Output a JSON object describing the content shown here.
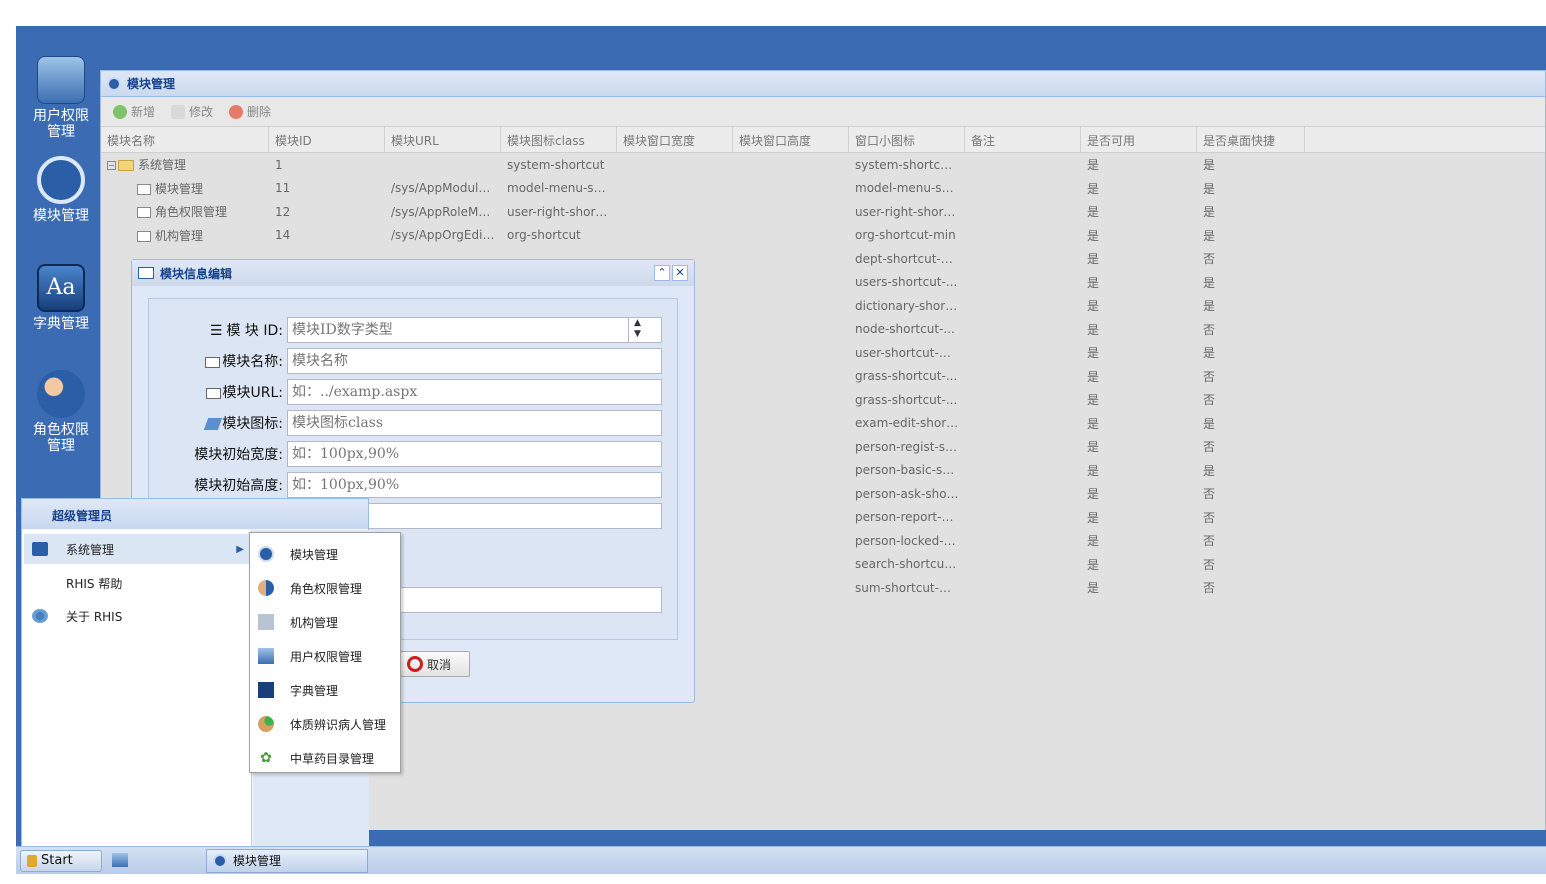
{
  "desktop": {
    "icons": [
      {
        "label": "用户权限\n管理",
        "icon": "user-permission-icon"
      },
      {
        "label": "模块管理",
        "icon": "module-icon"
      },
      {
        "label": "字典管理",
        "icon": "dictionary-icon"
      },
      {
        "label": "角色权限\n管理",
        "icon": "role-permission-icon"
      }
    ]
  },
  "window": {
    "title": "模块管理",
    "toolbar": {
      "add": "新增",
      "edit": "修改",
      "delete": "删除"
    },
    "columns": [
      "模块名称",
      "模块ID",
      "模块URL",
      "模块图标class",
      "模块窗口宽度",
      "模块窗口高度",
      "窗口小图标",
      "备注",
      "是否可用",
      "是否桌面快捷"
    ],
    "rows": [
      {
        "name": "系统管理",
        "id": "1",
        "url": "",
        "icon_class": "system-shortcut",
        "small_icon": "system-shortcut...",
        "enabled": "是",
        "desktop": "是"
      },
      {
        "name": "模块管理",
        "id": "11",
        "url": "/sys/AppModule...",
        "icon_class": "model-menu-sh...",
        "small_icon": "model-menu-sh...",
        "enabled": "是",
        "desktop": "是"
      },
      {
        "name": "角色权限管理",
        "id": "12",
        "url": "/sys/AppRoleMo...",
        "icon_class": "user-right-short...",
        "small_icon": "user-right-short...",
        "enabled": "是",
        "desktop": "是"
      },
      {
        "name": "机构管理",
        "id": "14",
        "url": "/sys/AppOrgEdit...",
        "icon_class": "org-shortcut",
        "small_icon": "org-shortcut-min",
        "enabled": "是",
        "desktop": "是"
      },
      {
        "small_icon": "dept-shortcut-min",
        "enabled": "是",
        "desktop": "否"
      },
      {
        "small_icon": "users-shortcut-...",
        "enabled": "是",
        "desktop": "是"
      },
      {
        "small_icon": "dictionary-short...",
        "enabled": "是",
        "desktop": "是"
      },
      {
        "small_icon": "node-shortcut-...",
        "enabled": "是",
        "desktop": "否"
      },
      {
        "small_icon": "user-shortcut-min",
        "enabled": "是",
        "desktop": "是"
      },
      {
        "small_icon": "grass-shortcut-...",
        "enabled": "是",
        "desktop": "否"
      },
      {
        "small_icon": "grass-shortcut-...",
        "enabled": "是",
        "desktop": "否"
      },
      {
        "small_icon": "exam-edit-short...",
        "enabled": "是",
        "desktop": "是"
      },
      {
        "small_icon": "person-regist-sh...",
        "enabled": "是",
        "desktop": "否"
      },
      {
        "small_icon": "person-basic-sh...",
        "enabled": "是",
        "desktop": "是"
      },
      {
        "small_icon": "person-ask-shor...",
        "enabled": "是",
        "desktop": "否"
      },
      {
        "small_icon": "person-report-s...",
        "enabled": "是",
        "desktop": "否"
      },
      {
        "small_icon": "person-locked-s...",
        "enabled": "是",
        "desktop": "否"
      },
      {
        "small_icon": "search-shortcut...",
        "enabled": "是",
        "desktop": "否"
      },
      {
        "small_icon": "sum-shortcut-min",
        "enabled": "是",
        "desktop": "否"
      }
    ]
  },
  "dialog": {
    "title": "模块信息编辑",
    "fields": [
      {
        "label": "模 块 ID:",
        "placeholder": "模块ID数字类型"
      },
      {
        "label": "模块名称:",
        "placeholder": "模块名称"
      },
      {
        "label": "模块URL:",
        "placeholder": "如：../examp.aspx"
      },
      {
        "label": "模块图标:",
        "placeholder": "模块图标class"
      },
      {
        "label": "模块初始宽度:",
        "placeholder": "如：100px,90%"
      },
      {
        "label": "模块初始高度:",
        "placeholder": "如：100px,90%"
      }
    ],
    "cancel": "取消"
  },
  "start_menu": {
    "title": "超级管理员",
    "items": [
      "系统管理",
      "RHIS 帮助",
      "关于 RHIS"
    ],
    "submenu": [
      "模块管理",
      "角色权限管理",
      "机构管理",
      "用户权限管理",
      "字典管理",
      "体质辨识病人管理",
      "中草药目录管理"
    ]
  },
  "taskbar": {
    "start": "Start",
    "task": "模块管理"
  }
}
